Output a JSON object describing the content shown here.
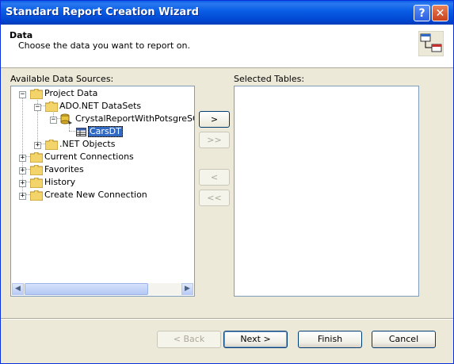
{
  "window": {
    "title": "Standard Report Creation Wizard"
  },
  "header": {
    "title": "Data",
    "subtitle": "Choose the data you want to report on.",
    "icon": "tables-link-icon"
  },
  "available": {
    "label": "Available Data Sources:",
    "tree": {
      "project_data": "Project Data",
      "ado_net": "ADO.NET DataSets",
      "dataset": "CrystalReportWithPotsgreSQL.D",
      "table": "CarsDT",
      "net_objects": ".NET Objects",
      "current_connections": "Current Connections",
      "favorites": "Favorites",
      "history": "History",
      "create_new": "Create New Connection"
    }
  },
  "selected": {
    "label": "Selected Tables:"
  },
  "move_buttons": {
    "add": ">",
    "add_all": ">>",
    "remove": "<",
    "remove_all": "<<"
  },
  "footer": {
    "back": "< Back",
    "next": "Next >",
    "finish": "Finish",
    "cancel": "Cancel"
  },
  "colors": {
    "title_bar": "#0a5fe6",
    "selection": "#316ac5",
    "dialog_bg": "#ece9d8"
  }
}
